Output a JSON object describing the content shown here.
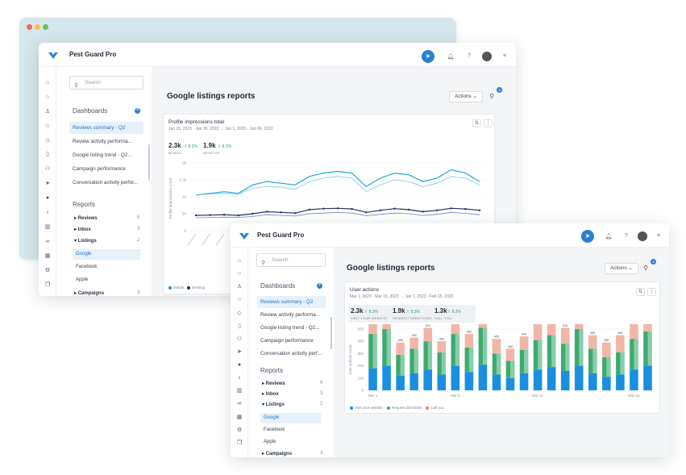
{
  "app_name": "Pest Guard Pro",
  "page_title": "Google listings reports",
  "actions_label": "Actions",
  "filter_badge": "3",
  "search_placeholder": "Search",
  "dashboards_title": "Dashboards",
  "reports_title": "Reports",
  "back_window": {
    "dashboards": [
      "Reviews summary - Q2",
      "Review activity performa...",
      "Google listing trend - Q2...",
      "Campaign performance",
      "Conversation activity perfor..."
    ],
    "reports": [
      {
        "label": "Reviews",
        "count": "6"
      },
      {
        "label": "Inbox",
        "count": "3"
      },
      {
        "label": "Listings",
        "count": "2"
      }
    ],
    "listings_children": [
      "Google",
      "Facebook",
      "Apple"
    ],
    "campaigns": {
      "label": "Campaigns",
      "count": "3"
    },
    "card_title": "Profile impressions total",
    "card_subtitle": "Jan 15, 2023 - Jan 30, 2023  →  Jan 1, 2023 - Jan 06, 2023",
    "kpis": [
      {
        "value": "2.3k",
        "change": "⇧ 8.2%",
        "label": "MOBILE"
      },
      {
        "value": "1.9k",
        "change": "⇧ 8.3%",
        "label": "DESKTOP"
      }
    ],
    "y_axis_label": "Profile impressions count",
    "legend": [
      "Mobile",
      "Desktop"
    ]
  },
  "front_window": {
    "dashboards": [
      "Reviews summary - Q2",
      "Review activity performa...",
      "Google listing trend - Q2...",
      "Campaign performance",
      "Conversation activity perf..."
    ],
    "reports": [
      {
        "label": "Reviews",
        "count": "6"
      },
      {
        "label": "Inbox",
        "count": "3"
      },
      {
        "label": "Listings",
        "count": "2"
      }
    ],
    "listings_children": [
      "Google",
      "Facebook",
      "Apple"
    ],
    "campaigns": {
      "label": "Campaigns",
      "count": "3"
    },
    "card_title": "User actions",
    "card_subtitle": "Mar 1, 2023 - Mar 15, 2023  →  Jan 1, 2023 - Feb 15, 2023",
    "kpis": [
      {
        "value": "2.3k",
        "change": "⇧ 8.3%",
        "label": "VISIT YOUR WEBSITE"
      },
      {
        "value": "1.9k",
        "change": "⇧ 8.3%",
        "label": "REQUEST DIRECTIONS"
      },
      {
        "value": "1.3k",
        "change": "⇧ 8.3%",
        "label": "CALL YOU"
      }
    ],
    "y_axis_label": "User actions count",
    "x_ticks": [
      "Mar 1",
      "Mar 6",
      "Mar 11",
      "Mar 16"
    ],
    "legend": [
      "Visit your website",
      "Request directions",
      "Call you"
    ]
  },
  "colors": {
    "accent": "#2b7fd3",
    "series_blue": "#1a8fe0",
    "series_green": "#3daa6e",
    "series_red": "#f2b6a8"
  },
  "chart_data": [
    {
      "type": "line",
      "title": "Profile impressions total",
      "ylabel": "Profile impressions count",
      "ylim": [
        0,
        2000
      ],
      "yticks": [
        "0",
        "50",
        "1k",
        "1.5k",
        "2k"
      ],
      "series": [
        {
          "name": "Mobile",
          "values": [
            1050,
            1100,
            1150,
            1100,
            1350,
            1450,
            1400,
            1350,
            1600,
            1700,
            1750,
            1700,
            1300,
            1550,
            1700,
            1650,
            1450,
            1550,
            1800,
            1700,
            1450
          ]
        },
        {
          "name": "Mobile",
          "values": [
            1050,
            1080,
            1100,
            1080,
            1250,
            1300,
            1280,
            1220,
            1450,
            1550,
            1600,
            1550,
            1150,
            1350,
            1500,
            1450,
            1300,
            1400,
            1600,
            1550,
            1350
          ]
        },
        {
          "name": "Desktop",
          "values": [
            450,
            460,
            470,
            450,
            500,
            560,
            540,
            520,
            620,
            650,
            660,
            640,
            540,
            600,
            650,
            620,
            560,
            600,
            660,
            640,
            600
          ]
        },
        {
          "name": "Desktop",
          "values": [
            380,
            390,
            400,
            390,
            420,
            470,
            450,
            430,
            500,
            520,
            540,
            520,
            440,
            480,
            520,
            500,
            450,
            480,
            540,
            510,
            470
          ]
        }
      ]
    },
    {
      "type": "bar",
      "title": "User actions",
      "ylabel": "User actions count",
      "ylim": [
        0,
        500
      ],
      "yticks": [
        "0",
        "100",
        "200",
        "300",
        "400",
        "500"
      ],
      "series": [
        {
          "name": "Visit your website",
          "values": [
            180,
            200,
            120,
            140,
            170,
            130,
            200,
            150,
            210,
            130,
            100,
            140,
            170,
            190,
            160,
            200,
            140,
            110,
            130,
            170,
            200
          ]
        },
        {
          "name": "Request directions",
          "values": [
            280,
            300,
            170,
            200,
            230,
            180,
            260,
            200,
            300,
            170,
            140,
            190,
            240,
            260,
            220,
            300,
            200,
            160,
            180,
            250,
            280
          ]
        },
        {
          "name": "Call you",
          "values": [
            120,
            120,
            100,
            90,
            110,
            90,
            100,
            110,
            120,
            120,
            100,
            110,
            140,
            140,
            130,
            110,
            110,
            120,
            140,
            150,
            130
          ]
        }
      ],
      "totals_labels": [
        "580",
        "620",
        "390",
        "430",
        "510",
        "400",
        "560",
        "460",
        "630",
        "420",
        "340",
        "440",
        "550",
        "590",
        "510",
        "610",
        "450",
        "390",
        "450",
        "570",
        "610"
      ]
    }
  ]
}
